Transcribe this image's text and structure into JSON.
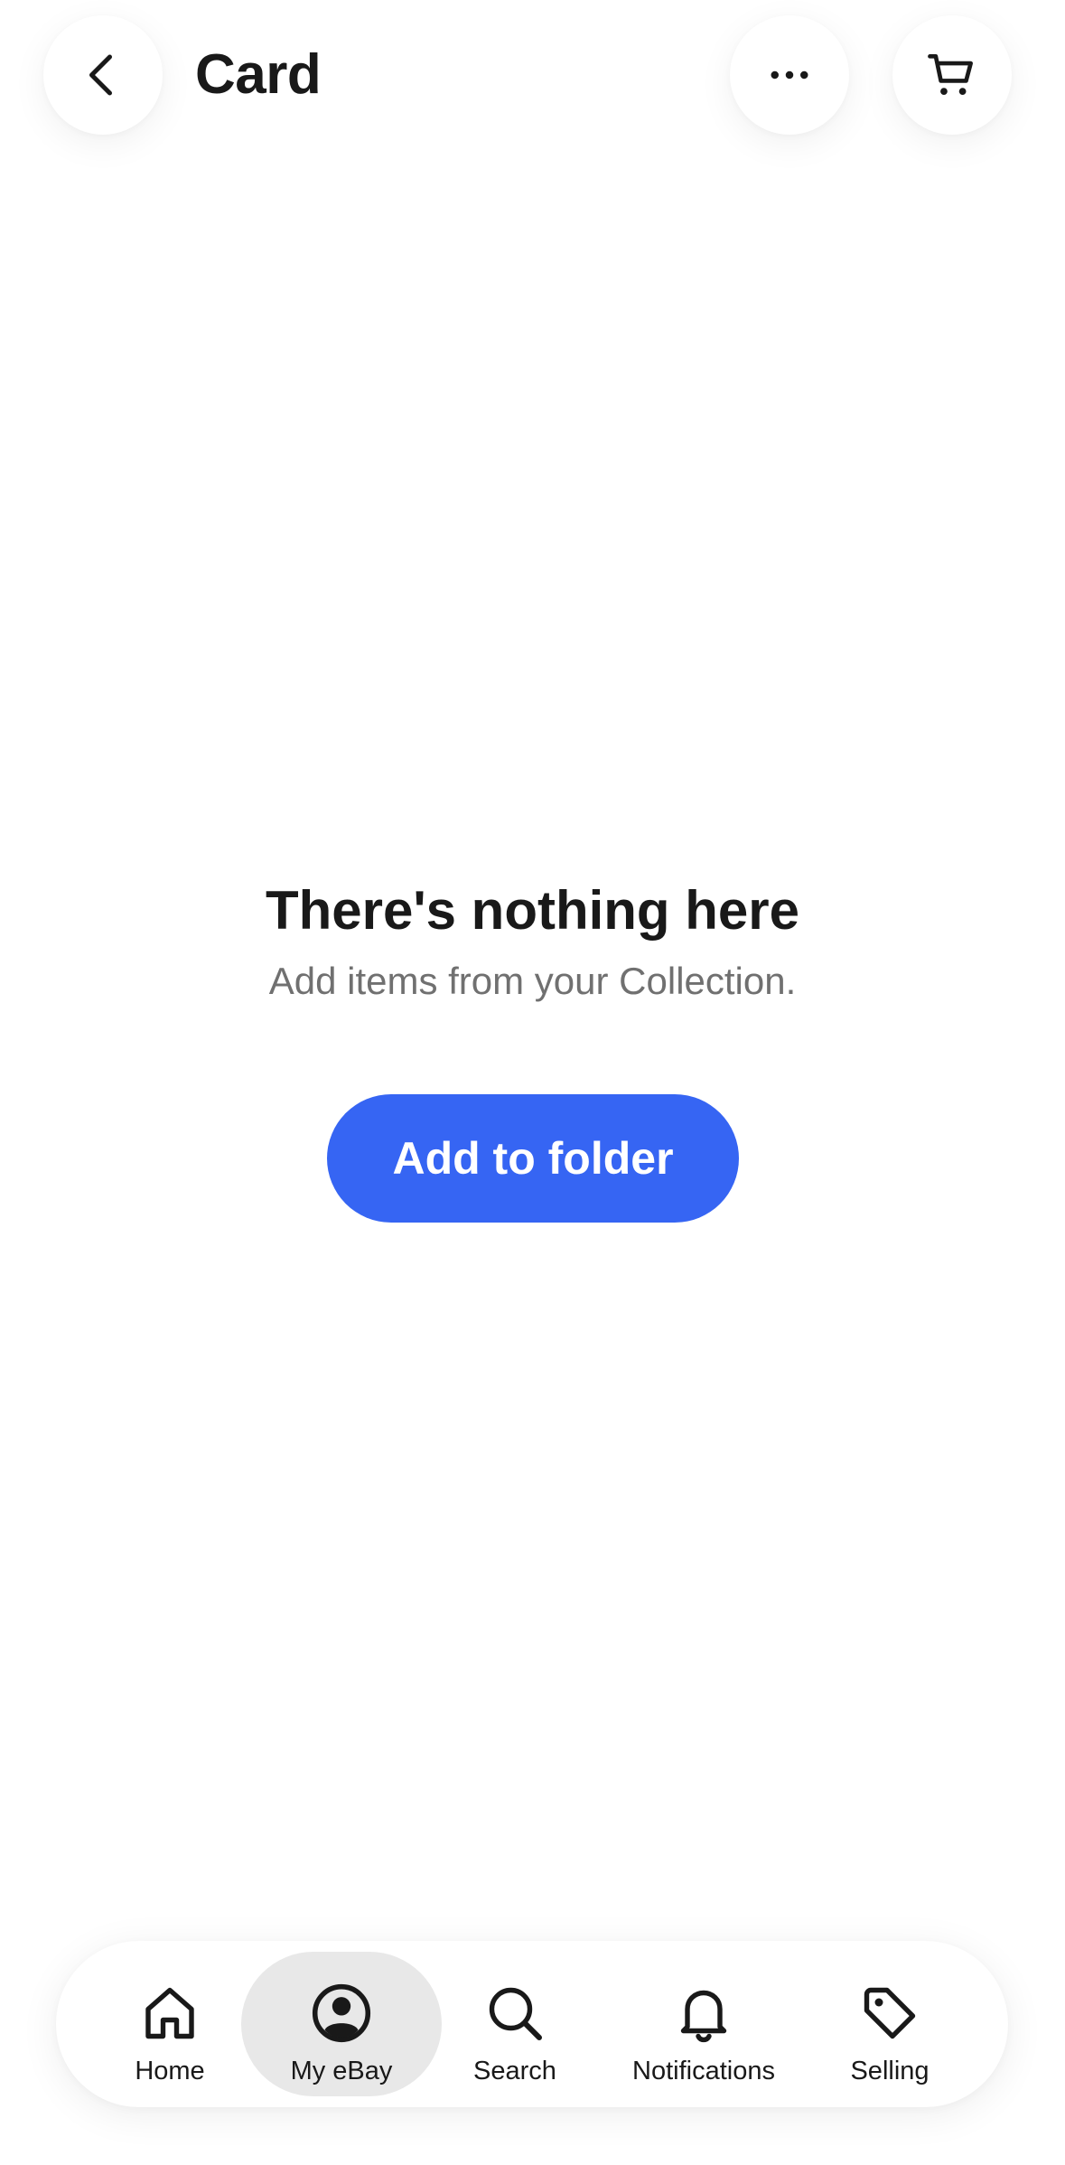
{
  "header": {
    "title": "Card",
    "back_icon": "chevron-left-icon",
    "more_icon": "more-horizontal-icon",
    "cart_icon": "cart-icon"
  },
  "empty_state": {
    "title": "There's nothing here",
    "subtitle": "Add items from your Collection.",
    "button_label": "Add to folder"
  },
  "bottom_nav": {
    "items": [
      {
        "label": "Home",
        "icon": "home-icon"
      },
      {
        "label": "My eBay",
        "icon": "profile-icon",
        "active": true
      },
      {
        "label": "Search",
        "icon": "search-icon"
      },
      {
        "label": "Notifications",
        "icon": "bell-icon"
      },
      {
        "label": "Selling",
        "icon": "tag-icon"
      }
    ]
  },
  "colors": {
    "accent": "#3665f3",
    "text_primary": "#191919",
    "text_secondary": "#707070",
    "nav_active_bg": "#e8e8e8"
  }
}
